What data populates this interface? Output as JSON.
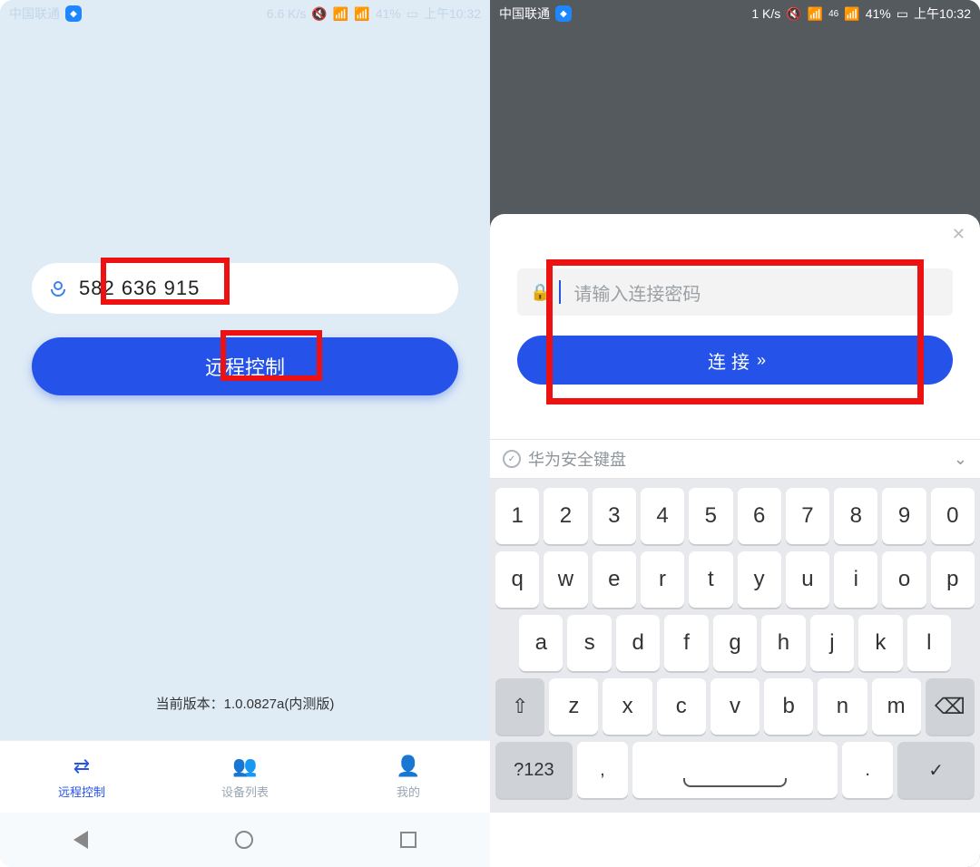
{
  "left": {
    "status": {
      "carrier": "中国联通",
      "net_speed": "6.6 K/s",
      "battery": "41%",
      "time": "上午10:32"
    },
    "id_value": "582 636 915",
    "action_label": "远程控制",
    "version": "当前版本：1.0.0827a(内测版)",
    "nav": {
      "remote": "远程控制",
      "devices": "设备列表",
      "mine": "我的"
    }
  },
  "right": {
    "status": {
      "carrier": "中国联通",
      "net_speed": "1 K/s",
      "signal_tag": "46",
      "battery": "41%",
      "time": "上午10:32"
    },
    "password_placeholder": "请输入连接密码",
    "connect_label": "连接",
    "keyboard_label": "华为安全键盘",
    "keys_row1": [
      "1",
      "2",
      "3",
      "4",
      "5",
      "6",
      "7",
      "8",
      "9",
      "0"
    ],
    "keys_row2": [
      "q",
      "w",
      "e",
      "r",
      "t",
      "y",
      "u",
      "i",
      "o",
      "p"
    ],
    "keys_row3": [
      "a",
      "s",
      "d",
      "f",
      "g",
      "h",
      "j",
      "k",
      "l"
    ],
    "keys_row4": [
      "z",
      "x",
      "c",
      "v",
      "b",
      "n",
      "m"
    ],
    "sym_key": "?123",
    "comma": ",",
    "period": "."
  }
}
